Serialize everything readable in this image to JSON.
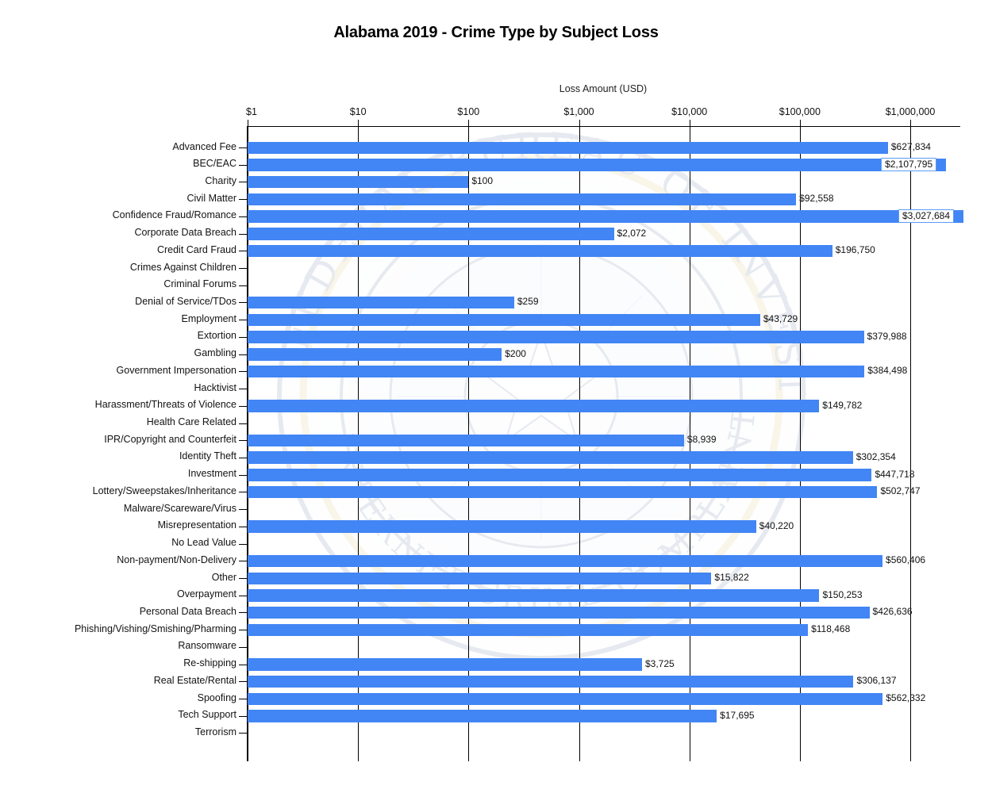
{
  "chart_data": {
    "type": "bar",
    "orientation": "horizontal",
    "title": "Alabama 2019 - Crime Type by Subject Loss",
    "xlabel": "Loss Amount (USD)",
    "ylabel": "",
    "xscale": "log",
    "xlim": [
      1,
      1000000
    ],
    "grid": true,
    "legend": false,
    "xticks": [
      {
        "value": 1,
        "label": "$1"
      },
      {
        "value": 10,
        "label": "$10"
      },
      {
        "value": 100,
        "label": "$100"
      },
      {
        "value": 1000,
        "label": "$1,000"
      },
      {
        "value": 10000,
        "label": "$10,000"
      },
      {
        "value": 100000,
        "label": "$100,000"
      },
      {
        "value": 1000000,
        "label": "$1,000,000"
      }
    ],
    "bar_color": "#4285F4",
    "watermark": "Federal Bureau of Investigation / Internet Crime Complaint Center seal",
    "categories": [
      "Advanced Fee",
      "BEC/EAC",
      "Charity",
      "Civil Matter",
      "Confidence Fraud/Romance",
      "Corporate Data Breach",
      "Credit Card Fraud",
      "Crimes Against Children",
      "Criminal Forums",
      "Denial of Service/TDos",
      "Employment",
      "Extortion",
      "Gambling",
      "Government Impersonation",
      "Hacktivist",
      "Harassment/Threats of Violence",
      "Health Care Related",
      "IPR/Copyright and Counterfeit",
      "Identity Theft",
      "Investment",
      "Lottery/Sweepstakes/Inheritance",
      "Malware/Scareware/Virus",
      "Misrepresentation",
      "No Lead Value",
      "Non-payment/Non-Delivery",
      "Other",
      "Overpayment",
      "Personal Data Breach",
      "Phishing/Vishing/Smishing/Pharming",
      "Ransomware",
      "Re-shipping",
      "Real Estate/Rental",
      "Spoofing",
      "Tech Support",
      "Terrorism"
    ],
    "values": [
      627834,
      2107795,
      100,
      92558,
      3027684,
      2072,
      196750,
      0,
      0,
      259,
      43729,
      379988,
      200,
      384498,
      0,
      149782,
      0,
      8939,
      302354,
      447718,
      502747,
      0,
      40220,
      0,
      560406,
      15822,
      150253,
      426636,
      118468,
      0,
      3725,
      306137,
      562332,
      17695,
      0
    ],
    "value_labels": [
      "$627,834",
      "$2,107,795",
      "$100",
      "$92,558",
      "$3,027,684",
      "$2,072",
      "$196,750",
      "",
      "",
      "$259",
      "$43,729",
      "$379,988",
      "$200",
      "$384,498",
      "",
      "$149,782",
      "",
      "$8,939",
      "$302,354",
      "$447,718",
      "$502,747",
      "",
      "$40,220",
      "",
      "$560,406",
      "$15,822",
      "$150,253",
      "$426,636",
      "$118,468",
      "",
      "$3,725",
      "$306,137",
      "$562,332",
      "$17,695",
      ""
    ]
  }
}
